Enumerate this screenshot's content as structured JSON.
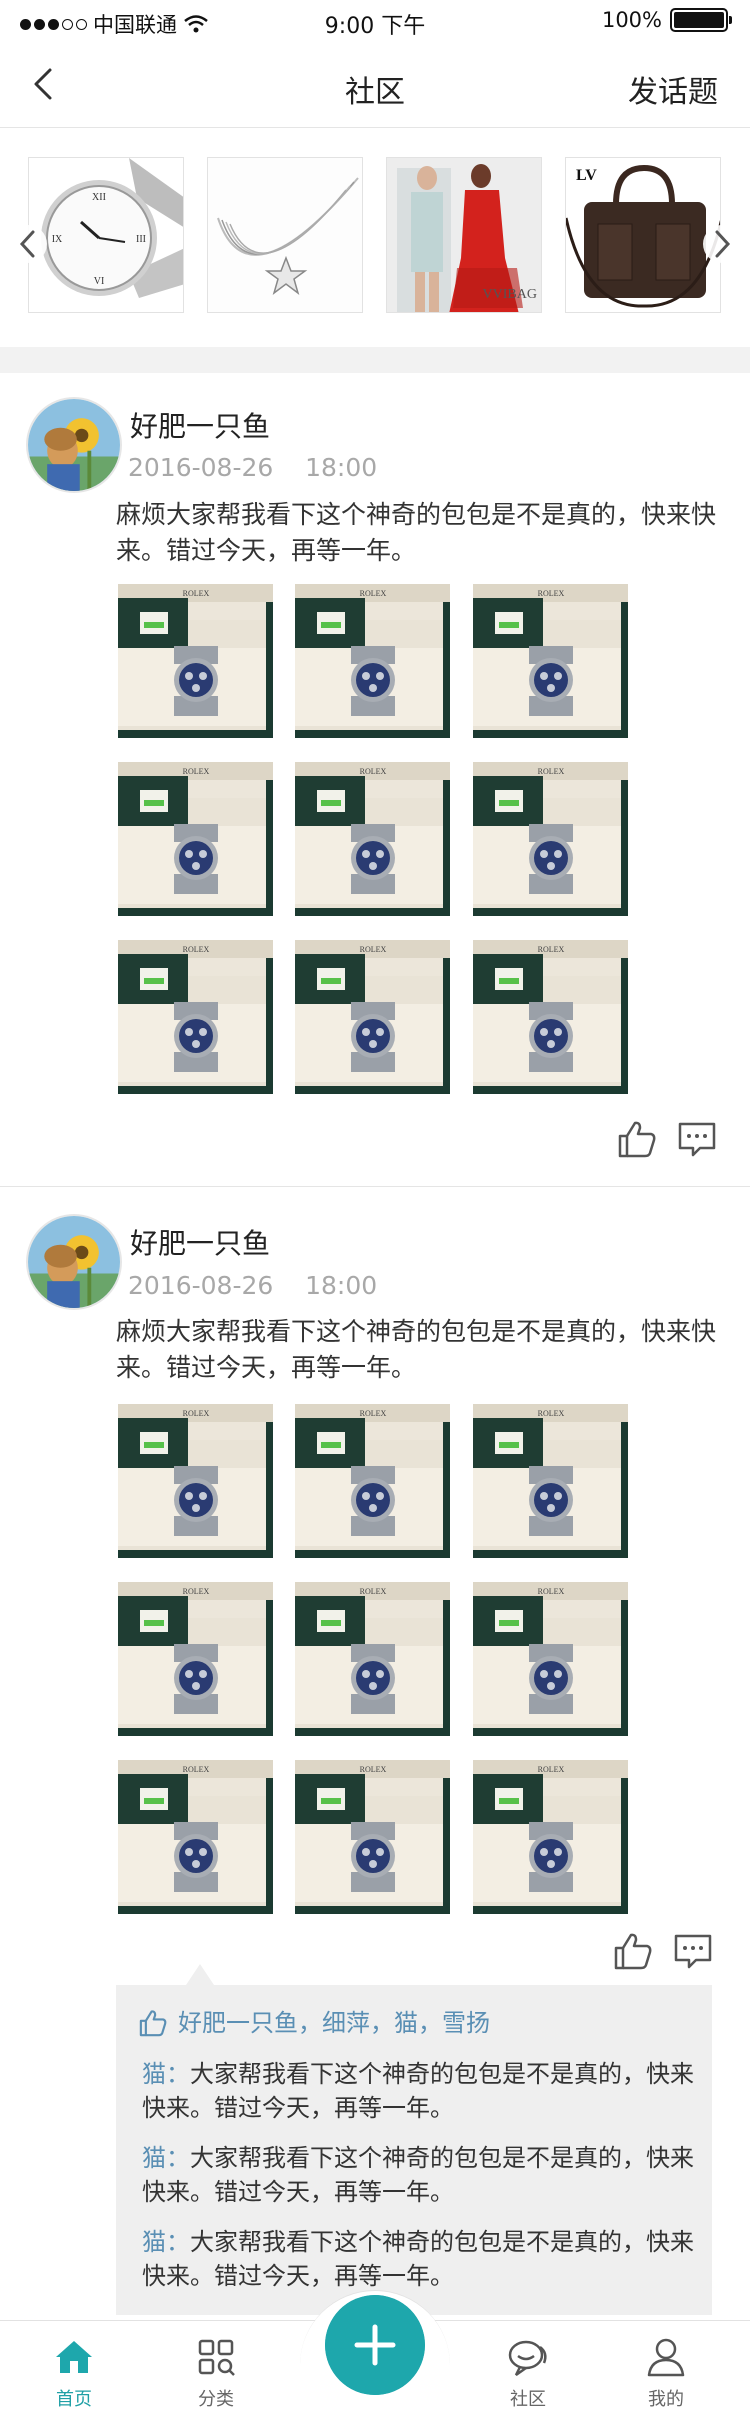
{
  "status_bar": {
    "carrier": "中国联通",
    "time": "9:00 下午",
    "battery": "100%",
    "battery_level": 1.0
  },
  "nav": {
    "title": "社区",
    "action": "发话题"
  },
  "carousel": {
    "items": [
      "watch",
      "necklace",
      "fashion-models",
      "handbag"
    ]
  },
  "posts": [
    {
      "author": "好肥一只鱼",
      "date": "2016-08-26",
      "time": "18:00",
      "text": "麻烦大家帮我看下这个神奇的包包是不是真的，快来快来。错过今天，再等一年。"
    },
    {
      "author": "好肥一只鱼",
      "date": "2016-08-26",
      "time": "18:00",
      "text": "麻烦大家帮我看下这个神奇的包包是不是真的，快来快来。错过今天，再等一年。",
      "likes": "好肥一只鱼，细萍，猫，雪扬",
      "comments": [
        {
          "name": "猫",
          "sep": "：",
          "text": "大家帮我看下这个神奇的包包是不是真的，快来快来。错过今天，再等一年。"
        },
        {
          "name": "猫",
          "sep": "：",
          "text": "大家帮我看下这个神奇的包包是不是真的，快来快来。错过今天，再等一年。"
        },
        {
          "name": "猫",
          "sep": "：",
          "text": "大家帮我看下这个神奇的包包是不是真的，快来快来。错过今天，再等一年。"
        }
      ]
    }
  ],
  "photo_brand": "ROLEX",
  "tabs": [
    {
      "label": "首页",
      "icon": "home-icon",
      "active": true
    },
    {
      "label": "分类",
      "icon": "category-icon",
      "active": false
    },
    {
      "label": "社区",
      "icon": "community-icon",
      "active": false
    },
    {
      "label": "我的",
      "icon": "user-icon",
      "active": false
    }
  ],
  "colors": {
    "accent": "#1ea7ac",
    "link": "#5a8fb4",
    "muted": "#a8a8a8"
  }
}
